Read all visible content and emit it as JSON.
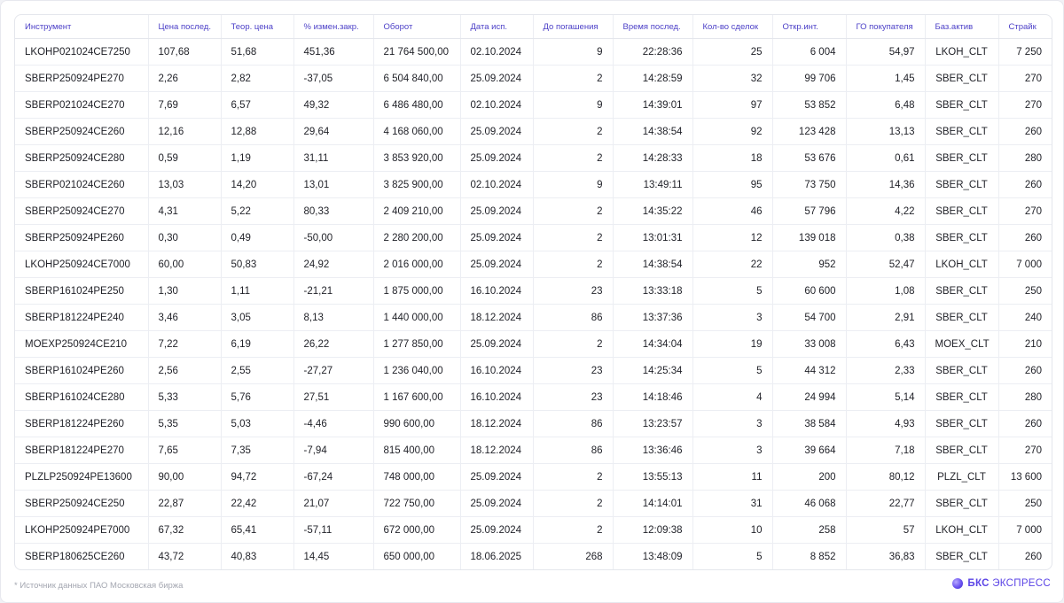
{
  "table": {
    "columns": [
      {
        "key": "instrument",
        "label": "Инструмент",
        "align": "l"
      },
      {
        "key": "last_price",
        "label": "Цена послед.",
        "align": "l"
      },
      {
        "key": "theor_price",
        "label": "Теор. цена",
        "align": "l"
      },
      {
        "key": "change_pct",
        "label": "% измен.закр.",
        "align": "l"
      },
      {
        "key": "turnover",
        "label": "Оборот",
        "align": "l"
      },
      {
        "key": "exp_date",
        "label": "Дата исп.",
        "align": "l"
      },
      {
        "key": "days_to_exp",
        "label": "До погашения",
        "align": "r"
      },
      {
        "key": "last_time",
        "label": "Время послед.",
        "align": "r"
      },
      {
        "key": "trades",
        "label": "Кол-во сделок",
        "align": "r"
      },
      {
        "key": "open_interest",
        "label": "Откр.инт.",
        "align": "r"
      },
      {
        "key": "buyer_margin",
        "label": "ГО покупателя",
        "align": "r"
      },
      {
        "key": "underlying",
        "label": "Баз.актив",
        "align": "c"
      },
      {
        "key": "strike",
        "label": "Страйк",
        "align": "r"
      }
    ],
    "rows": [
      [
        "LKOHP021024CE7250",
        "107,68",
        "51,68",
        "451,36",
        "21 764 500,00",
        "02.10.2024",
        "9",
        "22:28:36",
        "25",
        "6 004",
        "54,97",
        "LKOH_CLT",
        "7 250"
      ],
      [
        "SBERP250924PE270",
        "2,26",
        "2,82",
        "-37,05",
        "6 504 840,00",
        "25.09.2024",
        "2",
        "14:28:59",
        "32",
        "99 706",
        "1,45",
        "SBER_CLT",
        "270"
      ],
      [
        "SBERP021024CE270",
        "7,69",
        "6,57",
        "49,32",
        "6 486 480,00",
        "02.10.2024",
        "9",
        "14:39:01",
        "97",
        "53 852",
        "6,48",
        "SBER_CLT",
        "270"
      ],
      [
        "SBERP250924CE260",
        "12,16",
        "12,88",
        "29,64",
        "4 168 060,00",
        "25.09.2024",
        "2",
        "14:38:54",
        "92",
        "123 428",
        "13,13",
        "SBER_CLT",
        "260"
      ],
      [
        "SBERP250924CE280",
        "0,59",
        "1,19",
        "31,11",
        "3 853 920,00",
        "25.09.2024",
        "2",
        "14:28:33",
        "18",
        "53 676",
        "0,61",
        "SBER_CLT",
        "280"
      ],
      [
        "SBERP021024CE260",
        "13,03",
        "14,20",
        "13,01",
        "3 825 900,00",
        "02.10.2024",
        "9",
        "13:49:11",
        "95",
        "73 750",
        "14,36",
        "SBER_CLT",
        "260"
      ],
      [
        "SBERP250924CE270",
        "4,31",
        "5,22",
        "80,33",
        "2 409 210,00",
        "25.09.2024",
        "2",
        "14:35:22",
        "46",
        "57 796",
        "4,22",
        "SBER_CLT",
        "270"
      ],
      [
        "SBERP250924PE260",
        "0,30",
        "0,49",
        "-50,00",
        "2 280 200,00",
        "25.09.2024",
        "2",
        "13:01:31",
        "12",
        "139 018",
        "0,38",
        "SBER_CLT",
        "260"
      ],
      [
        "LKOHP250924CE7000",
        "60,00",
        "50,83",
        "24,92",
        "2 016 000,00",
        "25.09.2024",
        "2",
        "14:38:54",
        "22",
        "952",
        "52,47",
        "LKOH_CLT",
        "7 000"
      ],
      [
        "SBERP161024PE250",
        "1,30",
        "1,11",
        "-21,21",
        "1 875 000,00",
        "16.10.2024",
        "23",
        "13:33:18",
        "5",
        "60 600",
        "1,08",
        "SBER_CLT",
        "250"
      ],
      [
        "SBERP181224PE240",
        "3,46",
        "3,05",
        "8,13",
        "1 440 000,00",
        "18.12.2024",
        "86",
        "13:37:36",
        "3",
        "54 700",
        "2,91",
        "SBER_CLT",
        "240"
      ],
      [
        "MOEXP250924CE210",
        "7,22",
        "6,19",
        "26,22",
        "1 277 850,00",
        "25.09.2024",
        "2",
        "14:34:04",
        "19",
        "33 008",
        "6,43",
        "MOEX_CLT",
        "210"
      ],
      [
        "SBERP161024PE260",
        "2,56",
        "2,55",
        "-27,27",
        "1 236 040,00",
        "16.10.2024",
        "23",
        "14:25:34",
        "5",
        "44 312",
        "2,33",
        "SBER_CLT",
        "260"
      ],
      [
        "SBERP161024CE280",
        "5,33",
        "5,76",
        "27,51",
        "1 167 600,00",
        "16.10.2024",
        "23",
        "14:18:46",
        "4",
        "24 994",
        "5,14",
        "SBER_CLT",
        "280"
      ],
      [
        "SBERP181224PE260",
        "5,35",
        "5,03",
        "-4,46",
        "990 600,00",
        "18.12.2024",
        "86",
        "13:23:57",
        "3",
        "38 584",
        "4,93",
        "SBER_CLT",
        "260"
      ],
      [
        "SBERP181224PE270",
        "7,65",
        "7,35",
        "-7,94",
        "815 400,00",
        "18.12.2024",
        "86",
        "13:36:46",
        "3",
        "39 664",
        "7,18",
        "SBER_CLT",
        "270"
      ],
      [
        "PLZLP250924PE13600",
        "90,00",
        "94,72",
        "-67,24",
        "748 000,00",
        "25.09.2024",
        "2",
        "13:55:13",
        "11",
        "200",
        "80,12",
        "PLZL_CLT",
        "13 600"
      ],
      [
        "SBERP250924CE250",
        "22,87",
        "22,42",
        "21,07",
        "722 750,00",
        "25.09.2024",
        "2",
        "14:14:01",
        "31",
        "46 068",
        "22,77",
        "SBER_CLT",
        "250"
      ],
      [
        "LKOHP250924PE7000",
        "67,32",
        "65,41",
        "-57,11",
        "672 000,00",
        "25.09.2024",
        "2",
        "12:09:38",
        "10",
        "258",
        "57",
        "LKOH_CLT",
        "7 000"
      ],
      [
        "SBERP180625CE260",
        "43,72",
        "40,83",
        "14,45",
        "650 000,00",
        "18.06.2025",
        "268",
        "13:48:09",
        "5",
        "8 852",
        "36,83",
        "SBER_CLT",
        "260"
      ]
    ]
  },
  "footer": {
    "source_note": "* Источник данных ПАО Московская биржа",
    "brand_bold": "БКС",
    "brand_rest": "ЭКСПРЕСС"
  },
  "icons": {
    "brand_logo": "circle-logo-icon"
  },
  "colors": {
    "accent": "#5b44e6",
    "header_text": "#4b3fc7",
    "muted": "#a3a6b0"
  }
}
